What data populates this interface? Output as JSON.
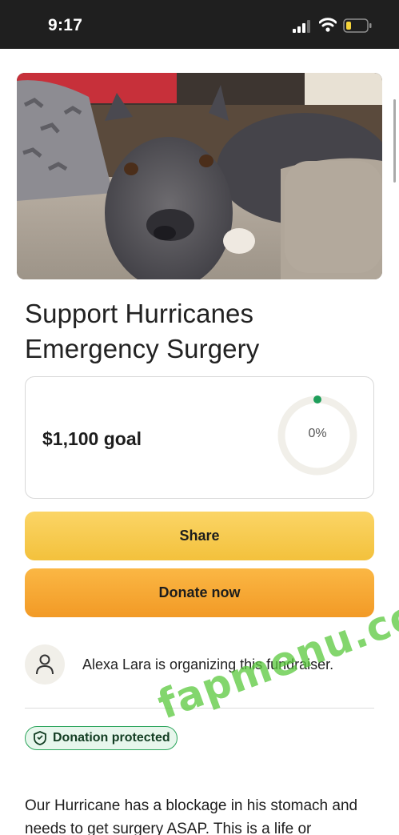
{
  "status_bar": {
    "time": "9:17",
    "icons": [
      "signal-icon",
      "wifi-icon",
      "battery-icon"
    ]
  },
  "fundraiser": {
    "title": "Support Hurricanes Emergency Surgery",
    "goal_label": "$1,100 goal",
    "progress_label": "0%",
    "progress_fraction": 0
  },
  "actions": {
    "share_label": "Share",
    "donate_label": "Donate now"
  },
  "organizer": {
    "text": "Alexa Lara is organizing this fundraiser.",
    "avatar_icon": "person-icon"
  },
  "badge": {
    "label": "Donation protected",
    "icon": "shield-icon"
  },
  "story": {
    "text": "Our Hurricane has a blockage in his stomach and needs to get surgery ASAP. This is a life or"
  },
  "watermark": {
    "text": "fapmenu.com"
  },
  "colors": {
    "status_bar_bg": "#1f1f1f",
    "share_button": "#f6c94a",
    "donate_button": "#f5a531",
    "progress_dot": "#1e9e5a",
    "badge_border": "#2ba55b",
    "watermark": "#5ac83c"
  }
}
